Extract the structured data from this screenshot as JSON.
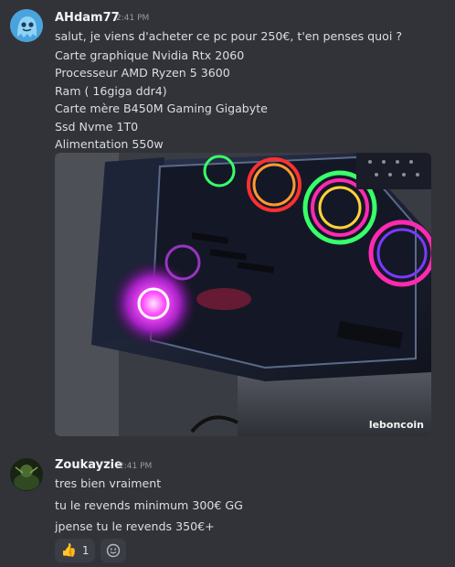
{
  "messages": [
    {
      "author": "AHdam77",
      "time": "2:41 PM",
      "avatar_icon": "blue-ghost-avatar",
      "lines": [
        "salut, je viens d'acheter ce pc pour 250€, t'en penses quoi ?",
        "Carte graphique Nvidia Rtx 2060",
        "Processeur AMD Ryzen 5 3600",
        "Ram ( 16giga ddr4)",
        "Carte mère B450M Gaming Gigabyte",
        "Ssd Nvme 1T0",
        "Alimentation 550w"
      ],
      "attachment": {
        "watermark": "leboncoin"
      }
    },
    {
      "author": "Zoukayzie",
      "time": "2:41 PM",
      "avatar_icon": "dark-green-avatar",
      "lines": [
        "tres bien vraiment",
        "tu le revends minimum 300€ GG",
        "jpense tu le revends 350€+"
      ]
    }
  ],
  "reactions": [
    {
      "emoji": "👍",
      "count": "1",
      "icon": "thumbs-up-icon"
    },
    {
      "icon": "add-reaction-icon"
    }
  ],
  "colors": {
    "background": "#323339",
    "username": "#f2f3f5",
    "text": "#dbdee1",
    "timestamp": "#949ba4",
    "avatar_blue": "#3b9fd8"
  }
}
